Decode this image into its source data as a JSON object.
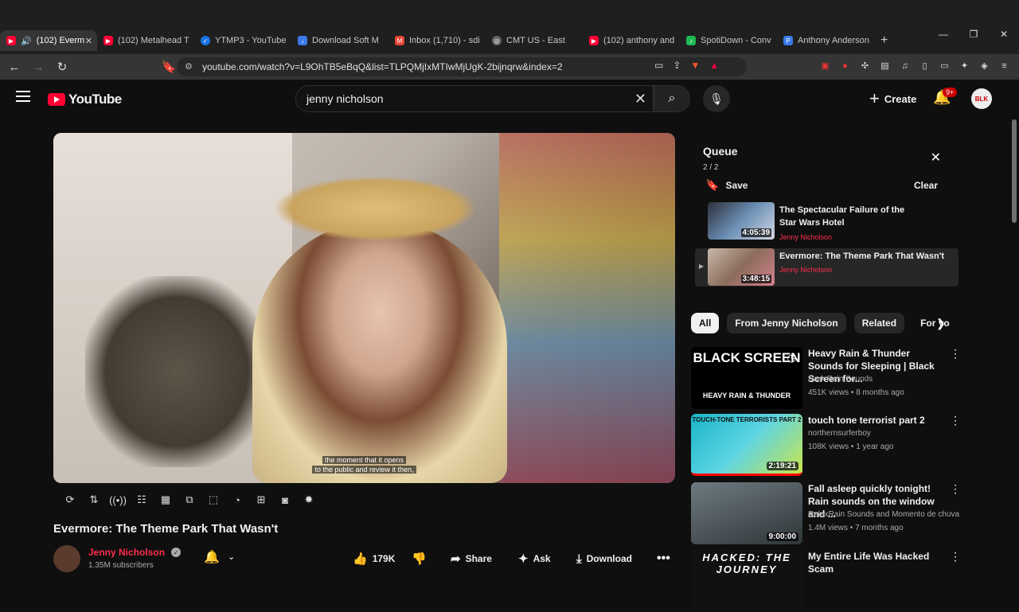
{
  "browser": {
    "tabs": [
      {
        "label": "(102) Everm",
        "favicon_color": "#ff0033",
        "active": true
      },
      {
        "label": "(102) Metalhead T",
        "favicon_color": "#ff0033"
      },
      {
        "label": "YTMP3 - YouTube",
        "favicon_color": "#1a73e8"
      },
      {
        "label": "Download Soft M",
        "favicon_color": "#3b78e7"
      },
      {
        "label": "Inbox (1,710) - sdi",
        "favicon_color": "#ea4335"
      },
      {
        "label": "CMT US - East",
        "favicon_color": "#888888"
      },
      {
        "label": "(102) anthony and",
        "favicon_color": "#ff0033"
      },
      {
        "label": "SpotiDown - Conv",
        "favicon_color": "#1db954"
      },
      {
        "label": "Anthony Anderson",
        "favicon_color": "#3b7be7"
      }
    ],
    "url": "youtube.com/watch?v=L9OhTB5eBqQ&list=TLPQMjIxMTIwMjUgK-2bijnqrw&index=2",
    "brave_badge": "1"
  },
  "youtube": {
    "logo_text": "YouTube",
    "search_value": "jenny nicholson",
    "create_label": "Create",
    "notif_badge": "9+",
    "avatar_text": "BLK"
  },
  "video": {
    "caption_line1": "the moment that it opens",
    "caption_line2": "to the public and review it then,",
    "title": "Evermore: The Theme Park That Wasn't",
    "channel": "Jenny Nicholson",
    "subscribers": "1.35M subscribers",
    "likes": "179K",
    "share_label": "Share",
    "ask_label": "Ask",
    "download_label": "Download"
  },
  "queue": {
    "title": "Queue",
    "count": "2 / 2",
    "save_label": "Save",
    "clear_label": "Clear",
    "items": [
      {
        "title": "The Spectacular Failure of the Star Wars Hotel",
        "channel": "Jenny Nicholson",
        "duration": "4:05:39"
      },
      {
        "title": "Evermore: The Theme Park That Wasn't",
        "channel": "Jenny Nicholson",
        "duration": "3:48:15"
      }
    ]
  },
  "chips": [
    "All",
    "From Jenny Nicholson",
    "Related",
    "For yo"
  ],
  "recommendations": [
    {
      "title": "Heavy Rain & Thunder Sounds for Sleeping | Black Screen for...",
      "channel": "Dark Rain Sounds",
      "meta": "451K views • 8 months ago",
      "duration": "",
      "thumb_text": "BLACK SCREEN",
      "thumb_sub": "HEAVY RAIN & THUNDER"
    },
    {
      "title": "touch tone terrorist part 2",
      "channel": "northernsurferboy",
      "meta": "108K views • 1 year ago",
      "duration": "2:19:21",
      "thumb_text": "TOUCH-TONE TERRORISTS PART 2",
      "thumb_sub": ""
    },
    {
      "title": "Fall asleep quickly tonight! Rain sounds on the window and ...",
      "channel": "RelaxRain Sounds and Momento de chuva",
      "meta": "1.4M views • 7 months ago",
      "duration": "9:00:00",
      "thumb_text": "",
      "thumb_sub": ""
    },
    {
      "title": "My Entire Life Was Hacked Scam",
      "channel": "",
      "meta": "",
      "duration": "",
      "thumb_text": "HACKED: THE JOURNEY",
      "thumb_sub": ""
    }
  ]
}
